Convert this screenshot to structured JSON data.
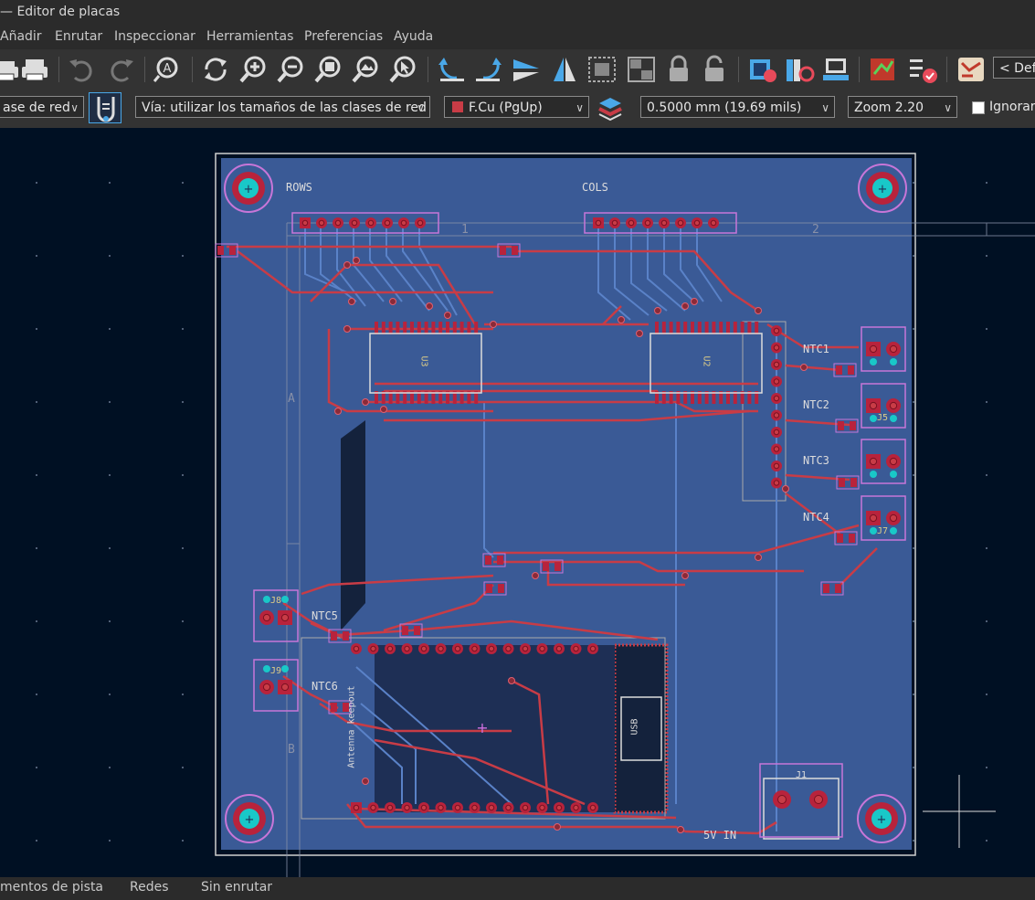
{
  "window": {
    "title": "— Editor de placas"
  },
  "menu": [
    "Añadir",
    "Enrutar",
    "Inspeccionar",
    "Herramientas",
    "Preferencias",
    "Ayuda"
  ],
  "toolbar": {
    "icons": [
      "print-icon",
      "plot-icon",
      "undo-icon",
      "redo-icon",
      "find-icon",
      "refresh-icon",
      "zoom-in-icon",
      "zoom-out-icon",
      "zoom-fit-icon",
      "zoom-objects-icon",
      "zoom-selection-icon",
      "rotate-ccw-icon",
      "rotate-cw-icon",
      "flip-icon",
      "mirror-icon",
      "group-icon",
      "ungroup-icon",
      "lock-icon",
      "unlock-icon",
      "netlist-icon",
      "library-icon",
      "footprint-viewer-icon",
      "drc-icon",
      "checklist-icon",
      "board-setup-icon"
    ],
    "layer_preset": "< Defa"
  },
  "options": {
    "track_width": "ase de red",
    "via_size": "Vía: utilizar los tamaños de las clases de red",
    "layer": "F.Cu (PgUp)",
    "grid": "0.5000 mm (19.69 mils)",
    "zoom": "Zoom 2.20",
    "ignore_label": "Ignorar"
  },
  "colors": {
    "board": "#3a5a96",
    "track": "#c83c46",
    "pad": "#b8233c",
    "silk": "#dcdcdc",
    "drill": "#19c8c8",
    "courtyard": "#c876d8"
  },
  "board": {
    "labels": {
      "rows": "ROWS",
      "cols": "COLS",
      "ntc1": "NTC1",
      "ntc2": "NTC2",
      "ntc3": "NTC3",
      "ntc4": "NTC4",
      "ntc5": "NTC5",
      "ntc6": "NTC6",
      "five_v": "5V IN",
      "usb": "USB",
      "antenna": "Antenna keepout",
      "u3": "U3",
      "u2": "U2",
      "j1": "J1",
      "j8": "J8",
      "j9": "J9",
      "j5": "J5",
      "j7": "J7",
      "sheet_1": "1",
      "sheet_2": "2",
      "sheet_a": "A",
      "sheet_b": "B"
    }
  },
  "status": [
    "mentos de pista",
    "Redes",
    "Sin enrutar"
  ]
}
